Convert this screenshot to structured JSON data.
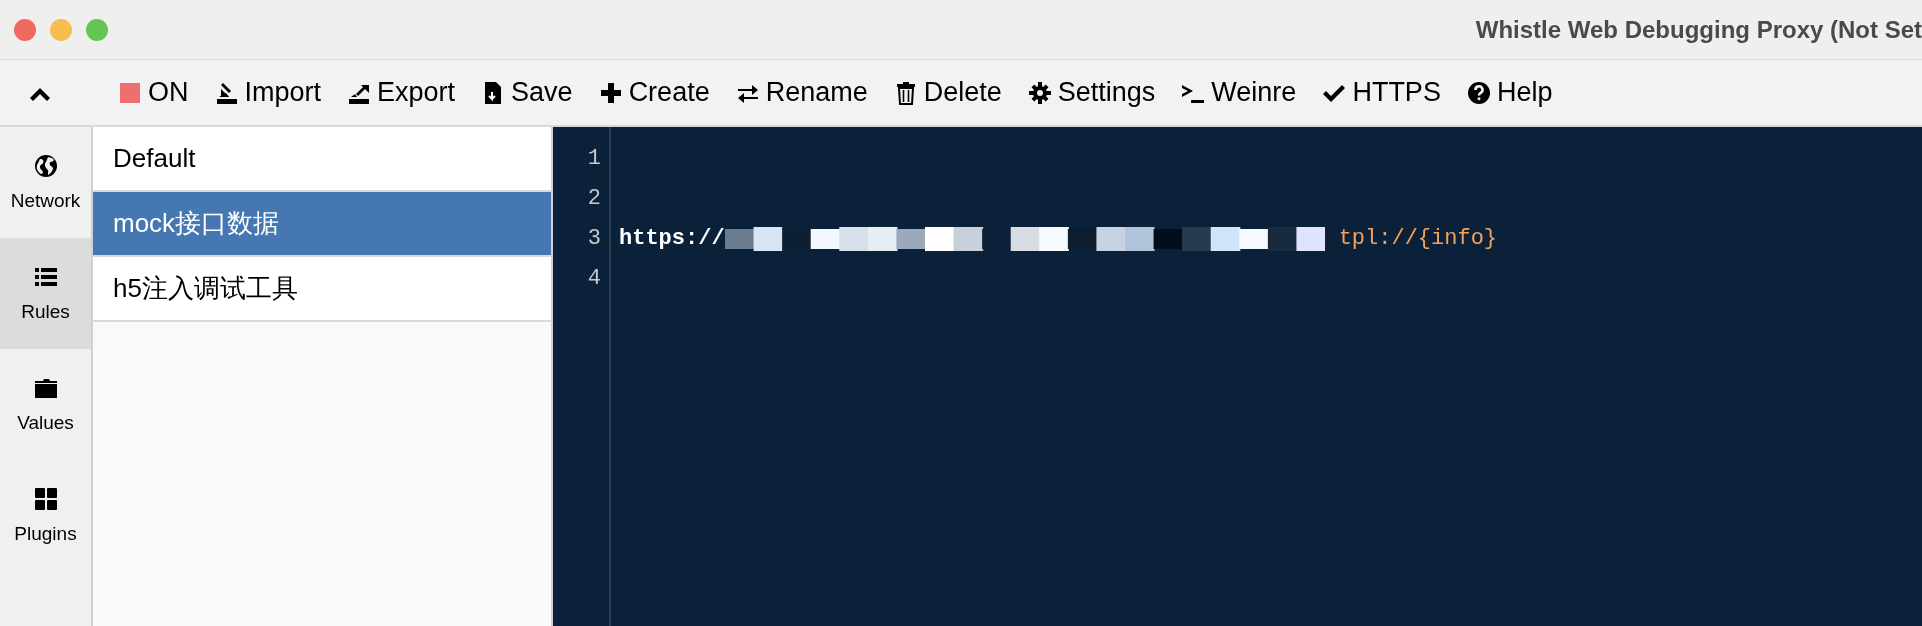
{
  "window": {
    "title": "Whistle Web Debugging Proxy (Not Set"
  },
  "toolbar": [
    {
      "label": "ON"
    },
    {
      "label": "Import"
    },
    {
      "label": "Export"
    },
    {
      "label": "Save"
    },
    {
      "label": "Create"
    },
    {
      "label": "Rename"
    },
    {
      "label": "Delete"
    },
    {
      "label": "Settings"
    },
    {
      "label": "Weinre"
    },
    {
      "label": "HTTPS"
    },
    {
      "label": "Help"
    }
  ],
  "sidebar": {
    "items": [
      {
        "label": "Network",
        "selected": false
      },
      {
        "label": "Rules",
        "selected": true
      },
      {
        "label": "Values",
        "selected": false
      },
      {
        "label": "Plugins",
        "selected": false
      }
    ]
  },
  "rule_list": [
    {
      "name": "Default",
      "selected": false
    },
    {
      "name": "mock接口数据",
      "selected": true
    },
    {
      "name": "h5注入调试工具",
      "selected": false
    }
  ],
  "editor": {
    "lines": [
      {
        "number": "1"
      },
      {
        "number": "2"
      },
      {
        "number": "3",
        "text": "https://",
        "redacted": true,
        "value": "tpl://{info}"
      },
      {
        "number": "4"
      }
    ]
  }
}
